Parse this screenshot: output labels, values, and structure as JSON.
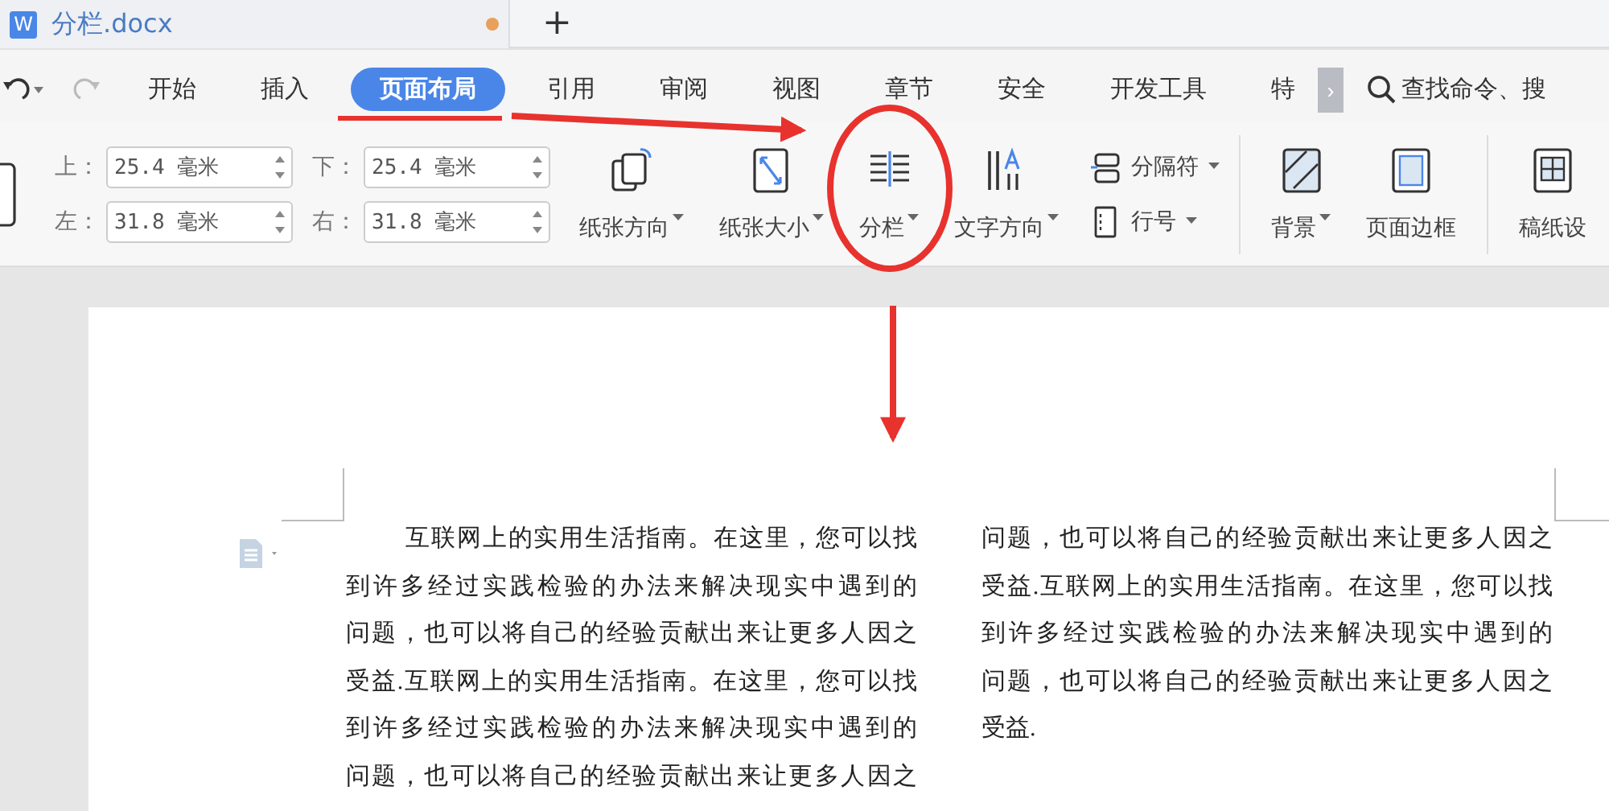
{
  "document_tab": {
    "title": "分栏.docx",
    "app_letter": "W",
    "modified": true
  },
  "new_tab": "+",
  "menu_tabs": [
    {
      "label": "开始",
      "selected": false
    },
    {
      "label": "插入",
      "selected": false
    },
    {
      "label": "页面布局",
      "selected": true
    },
    {
      "label": "引用",
      "selected": false
    },
    {
      "label": "审阅",
      "selected": false
    },
    {
      "label": "视图",
      "selected": false
    },
    {
      "label": "章节",
      "selected": false
    },
    {
      "label": "安全",
      "selected": false
    },
    {
      "label": "开发工具",
      "selected": false
    },
    {
      "label": "特",
      "selected": false
    }
  ],
  "more_tabs": "›",
  "search": {
    "placeholder": "查找命令、搜"
  },
  "margins": [
    {
      "label": "上：",
      "value": "25.4 毫米"
    },
    {
      "label": "下：",
      "value": "25.4 毫米"
    },
    {
      "label": "左：",
      "value": "31.8 毫米"
    },
    {
      "label": "右：",
      "value": "31.8 毫米"
    }
  ],
  "tools": [
    {
      "kind": "large",
      "label": "纸张方向",
      "dropdown": true
    },
    {
      "kind": "large",
      "label": "纸张大小",
      "dropdown": true
    },
    {
      "kind": "large",
      "label": "分栏",
      "dropdown": true
    },
    {
      "kind": "large",
      "label": "文字方向",
      "dropdown": true
    },
    {
      "kind": "small",
      "label": "分隔符",
      "dropdown": true
    },
    {
      "kind": "small",
      "label": "行号",
      "dropdown": true
    },
    {
      "kind": "separator"
    },
    {
      "kind": "large",
      "label": "背景",
      "dropdown": true
    },
    {
      "kind": "large",
      "label": "页面边框",
      "dropdown": false
    },
    {
      "kind": "separator"
    },
    {
      "kind": "large",
      "label": "稿纸设",
      "dropdown": false
    }
  ],
  "columns": [
    {
      "lines": [
        "互联网上的实用生活指南。在这里，您可以找",
        "到许多经过实践检验的办法来解决现实中遇到的",
        "问题，也可以将自己的经验贡献出来让更多人因之",
        "受益.互联网上的实用生活指南。在这里，您可以找",
        "到许多经过实践检验的办法来解决现实中遇到的",
        "问题，也可以将自己的经验贡献出来让更多人因之"
      ],
      "indent_first": true,
      "ends_paragraph": false
    },
    {
      "lines": [
        "问题，也可以将自己的经验贡献出来让更多人因之",
        "受益.互联网上的实用生活指南。在这里，您可以找",
        "到许多经过实践检验的办法来解决现实中遇到的",
        "问题，也可以将自己的经验贡献出来让更多人因之",
        "受益."
      ],
      "indent_first": false,
      "ends_paragraph": true
    }
  ]
}
